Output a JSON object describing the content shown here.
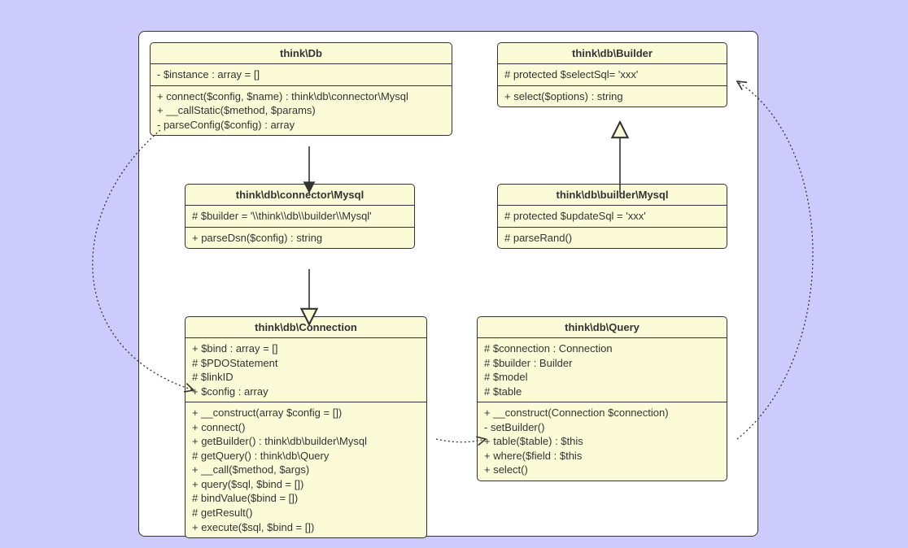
{
  "classes": {
    "db": {
      "title": "think\\Db",
      "attrs": [
        "- $instance : array = []"
      ],
      "methods": [
        "+ connect($config, $name) : think\\db\\connector\\Mysql",
        "+ __callStatic($method, $params)",
        "- parseConfig($config) : array"
      ]
    },
    "builder": {
      "title": "think\\db\\Builder",
      "attrs": [
        "# protected $selectSql= 'xxx'"
      ],
      "methods": [
        "+ select($options) : string"
      ]
    },
    "connectorMysql": {
      "title": "think\\db\\connector\\Mysql",
      "attrs": [
        "# $builder = '\\\\think\\\\db\\\\builder\\\\Mysql'"
      ],
      "methods": [
        "+ parseDsn($config) : string"
      ]
    },
    "builderMysql": {
      "title": "think\\db\\builder\\Mysql",
      "attrs": [
        "# protected $updateSql = 'xxx'"
      ],
      "methods": [
        "# parseRand()"
      ]
    },
    "connection": {
      "title": "think\\db\\Connection",
      "attrs": [
        "+ $bind : array = []",
        "# $PDOStatement",
        "# $linkID",
        "+ $config : array"
      ],
      "methods": [
        "+ __construct(array $config = [])",
        "+ connect()",
        "+ getBuilder() : think\\db\\builder\\Mysql",
        "# getQuery() : think\\db\\Query",
        "+ __call($method, $args)",
        "+ query($sql, $bind = [])",
        "# bindValue($bind = [])",
        "# getResult()",
        "+ execute($sql, $bind = [])"
      ]
    },
    "query": {
      "title": "think\\db\\Query",
      "attrs": [
        "# $connection : Connection",
        "# $builder : Builder",
        "# $model",
        "# $table"
      ],
      "methods": [
        "+ __construct(Connection $connection)",
        "- setBuilder()",
        "+ table($table) : $this",
        "+ where($field : $this",
        "+ select()"
      ]
    }
  },
  "chart_data": {
    "type": "uml-class-diagram",
    "classes": [
      {
        "id": "db",
        "name": "think\\Db",
        "attributes": [
          "- $instance : array = []"
        ],
        "methods": [
          "+ connect($config, $name) : think\\db\\connector\\Mysql",
          "+ __callStatic($method, $params)",
          "- parseConfig($config) : array"
        ]
      },
      {
        "id": "builder",
        "name": "think\\db\\Builder",
        "attributes": [
          "# protected $selectSql= 'xxx'"
        ],
        "methods": [
          "+ select($options) : string"
        ]
      },
      {
        "id": "connectorMysql",
        "name": "think\\db\\connector\\Mysql",
        "attributes": [
          "# $builder = '\\\\think\\\\db\\\\builder\\\\Mysql'"
        ],
        "methods": [
          "+ parseDsn($config) : string"
        ]
      },
      {
        "id": "builderMysql",
        "name": "think\\db\\builder\\Mysql",
        "attributes": [
          "# protected $updateSql = 'xxx'"
        ],
        "methods": [
          "# parseRand()"
        ]
      },
      {
        "id": "connection",
        "name": "think\\db\\Connection",
        "attributes": [
          "+ $bind : array = []",
          "# $PDOStatement",
          "# $linkID",
          "+ $config : array"
        ],
        "methods": [
          "+ __construct(array $config = [])",
          "+ connect()",
          "+ getBuilder() : think\\db\\builder\\Mysql",
          "# getQuery() : think\\db\\Query",
          "+ __call($method, $args)",
          "+ query($sql, $bind = [])",
          "# bindValue($bind = [])",
          "# getResult()",
          "+ execute($sql, $bind = [])"
        ]
      },
      {
        "id": "query",
        "name": "think\\db\\Query",
        "attributes": [
          "# $connection : Connection",
          "# $builder : Builder",
          "# $model",
          "# $table"
        ],
        "methods": [
          "+ __construct(Connection $connection)",
          "- setBuilder()",
          "+ table($table) : $this",
          "+ where($field : $this",
          "+ select()"
        ]
      }
    ],
    "relations": [
      {
        "from": "db",
        "to": "connectorMysql",
        "style": "solid",
        "arrow": "filled-triangle",
        "meaning": "creates/association"
      },
      {
        "from": "connectorMysql",
        "to": "connection",
        "style": "solid",
        "arrow": "open-triangle",
        "meaning": "inheritance (connector\\Mysql extends Connection)"
      },
      {
        "from": "builderMysql",
        "to": "builder",
        "style": "solid",
        "arrow": "open-triangle",
        "meaning": "inheritance (builder\\Mysql extends Builder)"
      },
      {
        "from": "db",
        "to": "connection",
        "style": "dotted",
        "arrow": "open-arrow",
        "meaning": "dependency"
      },
      {
        "from": "connection",
        "to": "query",
        "style": "dotted",
        "arrow": "open-arrow",
        "meaning": "dependency"
      },
      {
        "from": "query",
        "to": "builder",
        "style": "dotted",
        "arrow": "open-arrow",
        "meaning": "dependency"
      }
    ]
  }
}
